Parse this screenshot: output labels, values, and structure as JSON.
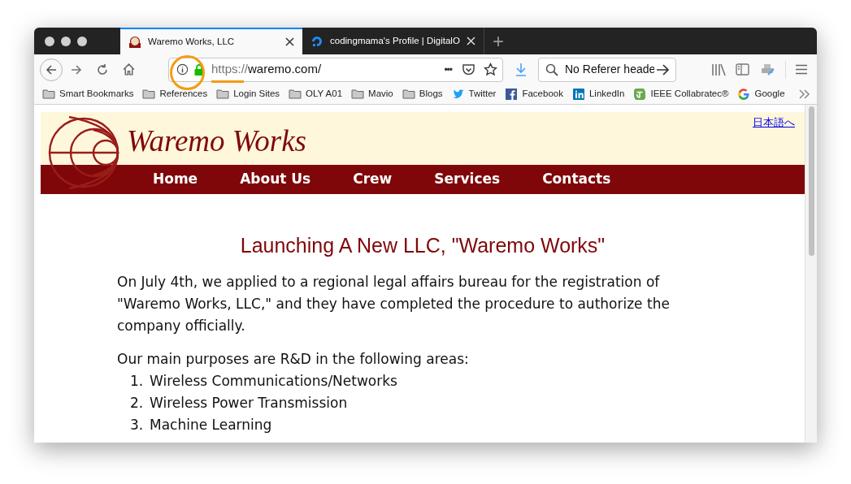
{
  "tabs": [
    {
      "title": "Waremo Works, LLC",
      "selected": true,
      "kind": "site"
    },
    {
      "title": "codingmama's Profile | DigitalO",
      "selected": false,
      "kind": "ring"
    }
  ],
  "new_tab": "+",
  "address": {
    "scheme": "https://",
    "host": "waremo.com/",
    "dots": "•••"
  },
  "search": {
    "value": "No Referer heade"
  },
  "bookmarks": [
    {
      "label": "Smart Bookmarks",
      "kind": "folder"
    },
    {
      "label": "References",
      "kind": "folder"
    },
    {
      "label": "Login Sites",
      "kind": "folder"
    },
    {
      "label": "OLY A01",
      "kind": "folder"
    },
    {
      "label": "Mavio",
      "kind": "folder"
    },
    {
      "label": "Blogs",
      "kind": "folder"
    },
    {
      "label": "Twitter",
      "kind": "bird"
    },
    {
      "label": "Facebook",
      "kind": "f"
    },
    {
      "label": "LinkedIn",
      "kind": "in"
    },
    {
      "label": "IEEE Collabratec®",
      "kind": "ct"
    },
    {
      "label": "Google",
      "kind": "g"
    }
  ],
  "page": {
    "language_link": "日本語へ",
    "site_name": "Waremo Works",
    "nav": [
      "Home",
      "About Us",
      "Crew",
      "Services",
      "Contacts"
    ],
    "heading": "Launching A New LLC, \"Waremo Works\"",
    "paragraphs": [
      "On July 4th, we applied to a regional legal affairs bureau for the registration of \"Waremo Works, LLC,\" and they have completed the procedure to authorize the company officially.",
      "Our main purposes are R&D in the following areas:"
    ],
    "list": [
      {
        "number": "1.",
        "text": "Wireless Communications/Networks"
      },
      {
        "number": "2.",
        "text": "Wireless Power Transmission"
      },
      {
        "number": "3.",
        "text": "Machine Learning"
      }
    ]
  }
}
